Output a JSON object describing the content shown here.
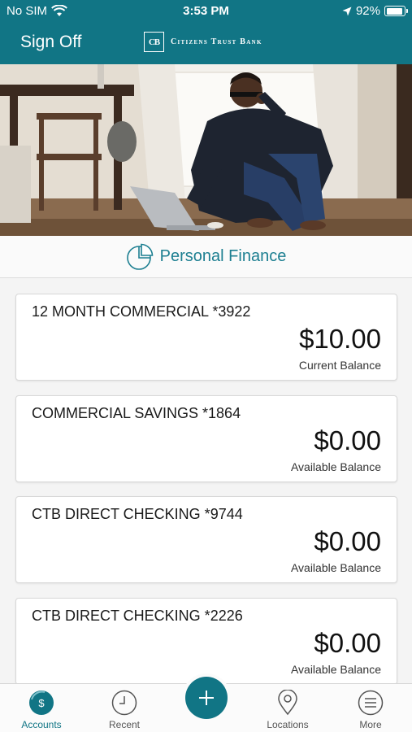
{
  "status_bar": {
    "carrier": "No SIM",
    "time": "3:53 PM",
    "battery": "92%",
    "battery_level": 0.92
  },
  "header": {
    "sign_off_label": "Sign Off",
    "bank_logo_letter": "CB",
    "bank_name": "Citizens Trust Bank",
    "background_color": "#117585"
  },
  "section": {
    "title": "Personal Finance",
    "icon": "pie-chart-icon"
  },
  "accounts": [
    {
      "name": "12 MONTH COMMERCIAL *3922",
      "amount": "$10.00",
      "balance_type": "Current Balance"
    },
    {
      "name": "COMMERCIAL SAVINGS *1864",
      "amount": "$0.00",
      "balance_type": "Available Balance"
    },
    {
      "name": "CTB DIRECT CHECKING *9744",
      "amount": "$0.00",
      "balance_type": "Available Balance"
    },
    {
      "name": "CTB DIRECT CHECKING *2226",
      "amount": "$0.00",
      "balance_type": "Available Balance"
    }
  ],
  "tabbar": {
    "tabs": [
      {
        "label": "Accounts",
        "icon": "dollar-coin-icon",
        "active": true
      },
      {
        "label": "Recent",
        "icon": "clock-icon",
        "active": false
      },
      {
        "label": "Locations",
        "icon": "map-pin-icon",
        "active": false
      },
      {
        "label": "More",
        "icon": "menu-icon",
        "active": false
      }
    ],
    "add_button_icon": "plus-icon"
  }
}
